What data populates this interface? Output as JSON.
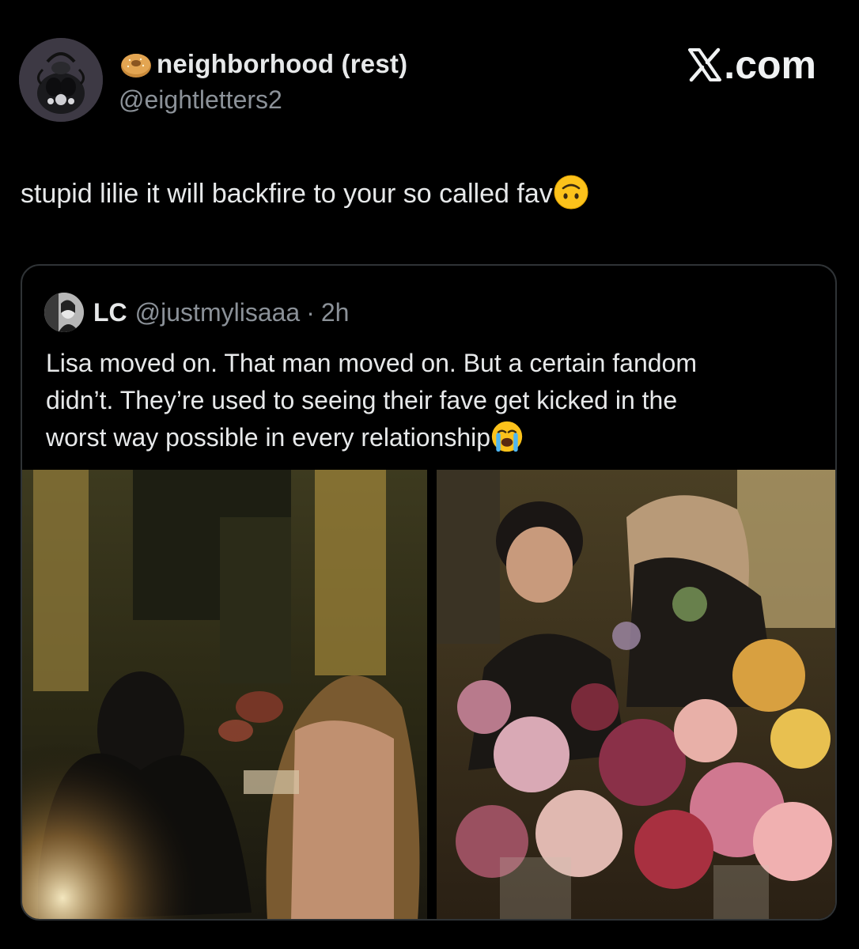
{
  "author": {
    "display_name": "neighborhood (rest)",
    "handle": "@eightletters2",
    "name_emoji": "bagel-icon"
  },
  "brand": {
    "label": ".com",
    "logo": "x-logo-icon"
  },
  "tweet": {
    "text": "stupid lilie it will backfire to your so called fav",
    "trailing_emoji": "upside-down-face-icon"
  },
  "quoted": {
    "name": "LC",
    "handle": "@justmylisaaa",
    "separator": "·",
    "time": "2h",
    "text_lines": [
      "Lisa moved on. That man moved on. But a certain fandom",
      "didn’t. They’re used to seeing their fave get kicked in the",
      "worst way possible in every relationship"
    ],
    "trailing_emoji": "loudly-crying-face-icon",
    "photos": [
      "dinner-photo-left",
      "dinner-photo-right"
    ]
  },
  "colors": {
    "background": "#000000",
    "text": "#e7e9ea",
    "secondary_text": "#8b9198",
    "border": "#2f3336"
  }
}
